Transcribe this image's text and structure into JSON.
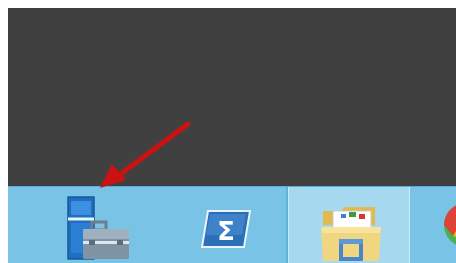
{
  "desktop": {
    "background_color": "#404040"
  },
  "annotation": {
    "icon": "red-arrow-icon",
    "color": "#cc1111",
    "points_to": "server-manager"
  },
  "taskbar": {
    "background_color": "#78c3e6",
    "items": [
      {
        "id": "server-manager",
        "icon": "server-manager-icon"
      },
      {
        "id": "powershell",
        "icon": "powershell-icon"
      },
      {
        "id": "file-explorer",
        "icon": "file-explorer-icon",
        "state": "active"
      },
      {
        "id": "chrome",
        "icon": "chrome-icon"
      }
    ]
  }
}
